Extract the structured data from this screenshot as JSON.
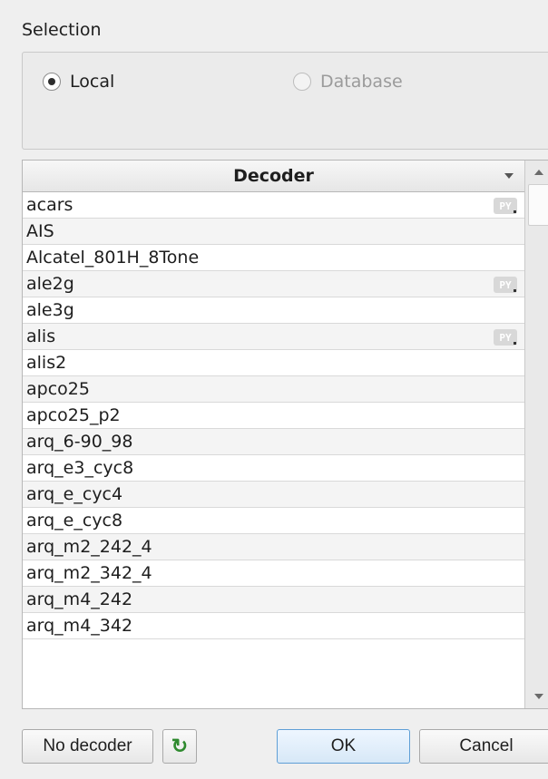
{
  "selection": {
    "title": "Selection",
    "local_label": "Local",
    "database_label": "Database",
    "selected": "Local"
  },
  "table": {
    "column_header": "Decoder",
    "rows": [
      {
        "name": "acars",
        "py": true
      },
      {
        "name": "AIS",
        "py": false
      },
      {
        "name": "Alcatel_801H_8Tone",
        "py": false
      },
      {
        "name": "ale2g",
        "py": true
      },
      {
        "name": "ale3g",
        "py": false
      },
      {
        "name": "alis",
        "py": true
      },
      {
        "name": "alis2",
        "py": false
      },
      {
        "name": "apco25",
        "py": false
      },
      {
        "name": "apco25_p2",
        "py": false
      },
      {
        "name": "arq_6-90_98",
        "py": false
      },
      {
        "name": "arq_e3_cyc8",
        "py": false
      },
      {
        "name": "arq_e_cyc4",
        "py": false
      },
      {
        "name": "arq_e_cyc8",
        "py": false
      },
      {
        "name": "arq_m2_242_4",
        "py": false
      },
      {
        "name": "arq_m2_342_4",
        "py": false
      },
      {
        "name": "arq_m4_242",
        "py": false
      },
      {
        "name": "arq_m4_342",
        "py": false
      }
    ],
    "py_badge": "PY"
  },
  "buttons": {
    "no_decoder": "No decoder",
    "refresh_icon": "refresh-icon",
    "ok": "OK",
    "cancel": "Cancel"
  },
  "colors": {
    "refresh_green": "#2f8a2f",
    "ok_border": "#5f9fd6"
  }
}
